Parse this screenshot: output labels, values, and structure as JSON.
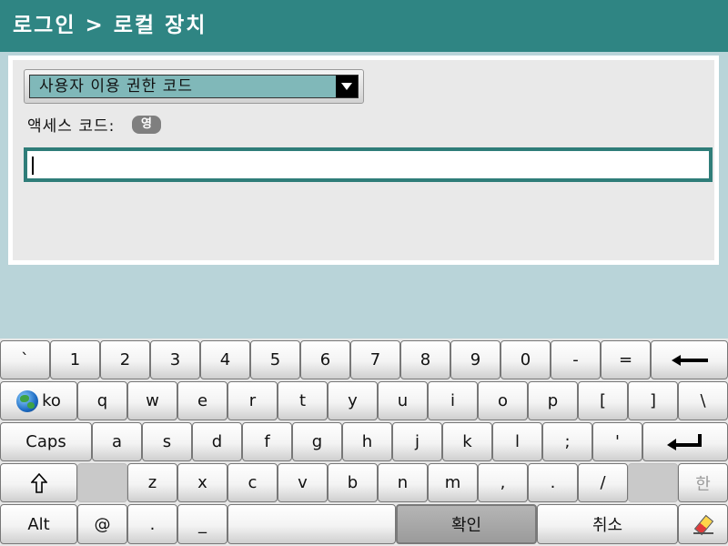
{
  "window": {
    "title": "로그인 > 로컬 장치"
  },
  "form": {
    "dropdown_value": "사용자 이용 권한 코드",
    "access_label": "액세스 코드:",
    "input_mode": "영",
    "code_value": ""
  },
  "keyboard": {
    "rows": [
      [
        "`",
        "1",
        "2",
        "3",
        "4",
        "5",
        "6",
        "7",
        "8",
        "9",
        "0",
        "-",
        "=",
        "backspace"
      ],
      [
        "ko",
        "q",
        "w",
        "e",
        "r",
        "t",
        "y",
        "u",
        "i",
        "o",
        "p",
        "[",
        "]",
        "\\"
      ],
      [
        "Caps",
        "a",
        "s",
        "d",
        "f",
        "g",
        "h",
        "j",
        "k",
        "l",
        ";",
        "'",
        "enter"
      ],
      [
        "shift",
        "",
        "z",
        "x",
        "c",
        "v",
        "b",
        "n",
        "m",
        ",",
        ".",
        "/",
        "",
        "한"
      ],
      [
        "Alt",
        "@",
        ".",
        "_",
        "space",
        "확인",
        "취소",
        "eraser"
      ]
    ],
    "labels": {
      "ko": "ko",
      "caps": "Caps",
      "alt": "Alt",
      "hangul": "한",
      "confirm": "확인",
      "cancel": "취소"
    },
    "icons": {
      "backspace": "left-arrow-icon",
      "enter": "enter-arrow-icon",
      "shift": "shift-arrow-icon",
      "globe": "globe-icon",
      "eraser": "eraser-icon"
    }
  },
  "colors": {
    "titlebar": "#2f8583",
    "accent": "#2f7d79",
    "dropdown": "#80b8b9"
  }
}
